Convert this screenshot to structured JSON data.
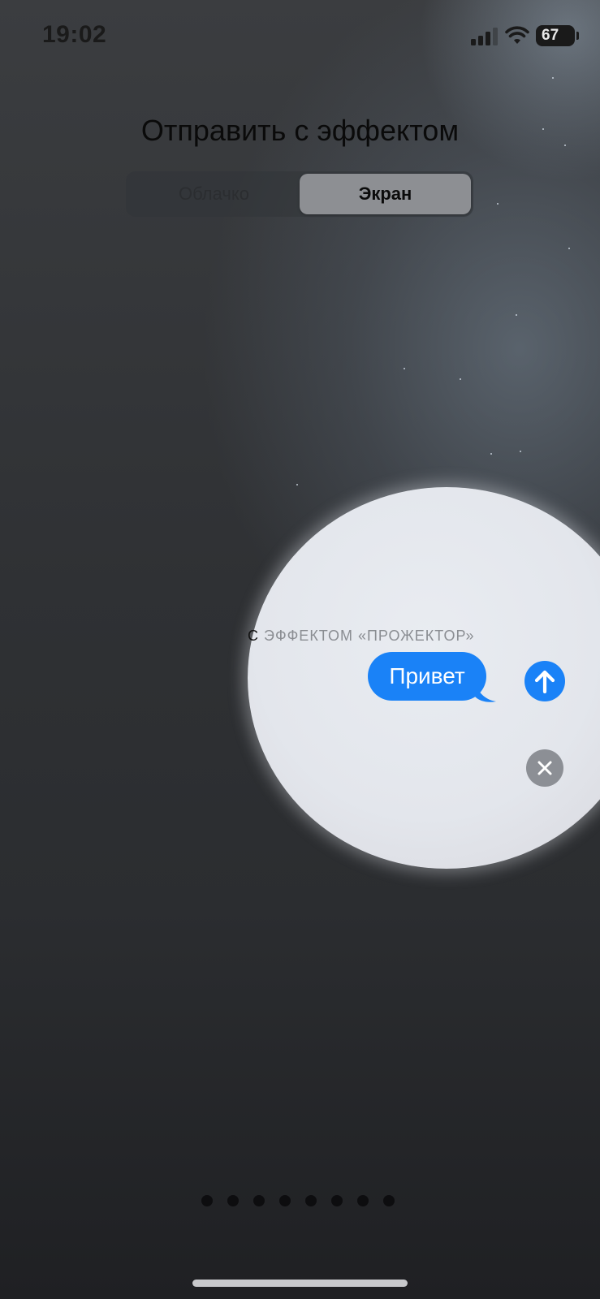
{
  "status_bar": {
    "time": "19:02",
    "battery": "67",
    "icons": [
      "signal-icon",
      "wifi-icon",
      "battery-icon"
    ]
  },
  "header": {
    "title": "Отправить с эффектом"
  },
  "segmented_control": {
    "tabs": [
      {
        "label": "Облачко",
        "selected": false
      },
      {
        "label": "Экран",
        "selected": true
      }
    ]
  },
  "preview": {
    "effect_label_prefix": "С",
    "effect_label_rest": " ЭФФЕКТОМ «ПРОЖЕКТОР»",
    "message": "Привет",
    "send_icon": "arrow-up-icon",
    "close_icon": "close-icon"
  },
  "pager": {
    "page_count": 8
  },
  "colors": {
    "accent": "#1a82f7",
    "close_button": "#8c8f95"
  }
}
